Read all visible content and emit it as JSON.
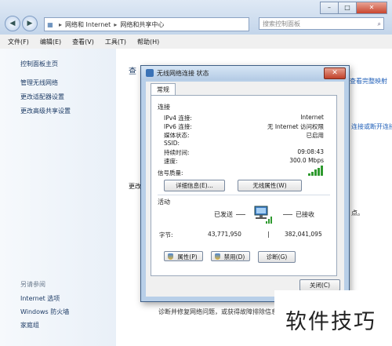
{
  "explorer": {
    "address": [
      "网络和 Internet",
      "网络和共享中心"
    ],
    "search_placeholder": "搜索控制面板",
    "menu": [
      "文件(F)",
      "编辑(E)",
      "查看(V)",
      "工具(T)",
      "帮助(H)"
    ],
    "sidebar": {
      "home": "控制面板主页",
      "links": [
        "管理无线网络",
        "更改适配器设置",
        "更改高级共享设置"
      ],
      "see_also": "另请参阅",
      "see_also_links": [
        "Internet 选项",
        "Windows 防火墙",
        "家庭组"
      ]
    },
    "content": {
      "heading_partial": "查",
      "right_link_1": "查看完整映射",
      "right_link_2": "连接或断开连接",
      "change_partial": "更改",
      "dot_text": "点。",
      "bottom_text": "诊断并修复网络问题，或获得故障排除信息。"
    }
  },
  "dialog": {
    "title": "无线网络连接 状态",
    "close_label": "✕",
    "tab_label": "常规",
    "connection_group": "连接",
    "rows": [
      {
        "label": "IPv4 连接:",
        "value": "Internet"
      },
      {
        "label": "IPv6 连接:",
        "value": "无 Internet 访问权限"
      },
      {
        "label": "媒体状态:",
        "value": "已启用"
      },
      {
        "label": "SSID:",
        "value": ""
      },
      {
        "label": "持续时间:",
        "value": "09:08:43"
      },
      {
        "label": "速度:",
        "value": "300.0 Mbps"
      }
    ],
    "signal_label": "信号质量:",
    "signal_level": 5,
    "details_button": "详细信息(E)...",
    "wireless_props_button": "无线属性(W)",
    "activity_group": "活动",
    "sent_label": "已发送",
    "received_label": "已接收",
    "bytes_label": "字节:",
    "bytes_sent": "43,771,950",
    "bytes_received": "382,041,095",
    "properties_button": "属性(P)",
    "disable_button": "禁用(D)",
    "diagnose_button": "诊断(G)",
    "close_button": "关闭(C)"
  },
  "overlay": {
    "watermark_text": "软件技巧"
  }
}
